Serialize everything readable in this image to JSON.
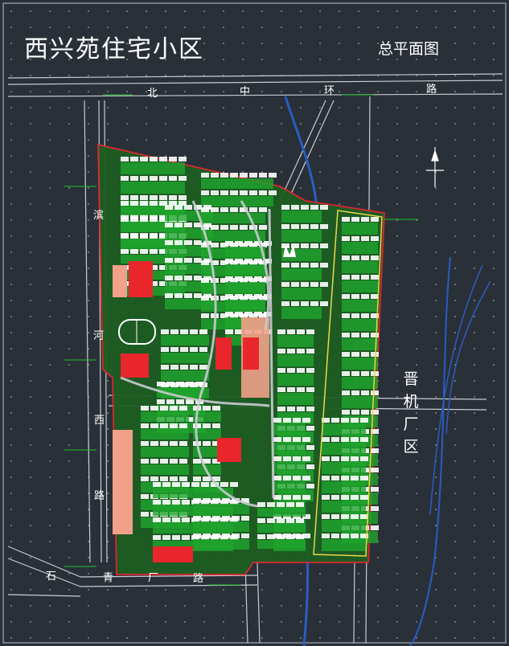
{
  "title": "西兴苑住宅小区",
  "subtitle": "总平面图",
  "roads": {
    "north": [
      "北",
      "中",
      "环",
      "路"
    ],
    "west": [
      "滨",
      "河",
      "西",
      "路"
    ],
    "south": [
      "石",
      "青",
      "厂",
      "路"
    ]
  },
  "district": [
    "晋",
    "机",
    "厂",
    "区"
  ],
  "colors": {
    "background": "#2a3038",
    "road_line": "#c9ccd1",
    "boundary": "#e8262c",
    "green": "#1f9e2a",
    "building": "#ffffff",
    "river": "#2a5cc4",
    "yellow_road": "#e8d84a",
    "salmon": "#f1a08a"
  },
  "icons": {
    "north_arrow": "north-arrow-icon",
    "compass_figure": "compass-figure-icon"
  }
}
